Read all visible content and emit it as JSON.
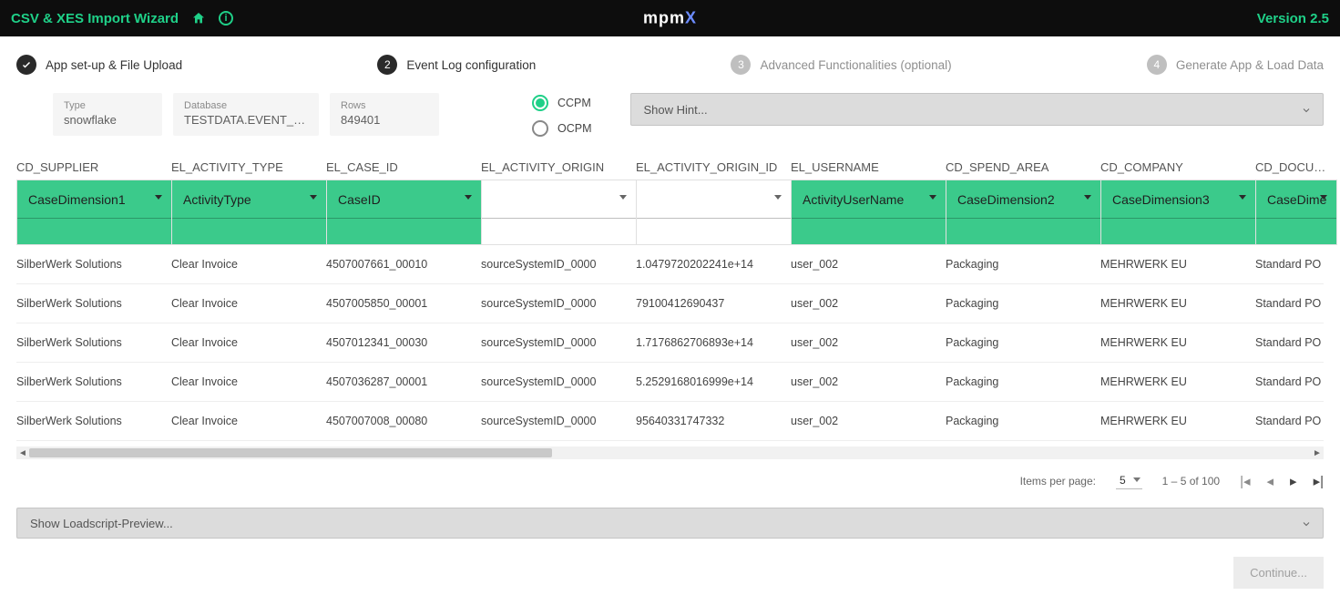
{
  "header": {
    "title": "CSV & XES Import Wizard",
    "logo_main": "mpm",
    "logo_x": "X",
    "version": "Version 2.5"
  },
  "stepper": {
    "s1": "App set-up & File Upload",
    "s1_mark": "✓",
    "s2": "Event Log configuration",
    "s2_num": "2",
    "s3": "Advanced Functionalities (optional)",
    "s3_num": "3",
    "s4": "Generate App & Load Data",
    "s4_num": "4"
  },
  "info": {
    "type_label": "Type",
    "type_value": "snowflake",
    "db_label": "Database",
    "db_value": "TESTDATA.EVENT_LOGS.",
    "rows_label": "Rows",
    "rows_value": "849401"
  },
  "radios": {
    "ccpm": "CCPM",
    "ocpm": "OCPM"
  },
  "hint": "Show Hint...",
  "columns": [
    {
      "header": "CD_SUPPLIER",
      "mapping": "CaseDimension1",
      "green": true
    },
    {
      "header": "EL_ACTIVITY_TYPE",
      "mapping": "ActivityType",
      "green": true
    },
    {
      "header": "EL_CASE_ID",
      "mapping": "CaseID",
      "green": true
    },
    {
      "header": "EL_ACTIVITY_ORIGIN",
      "mapping": "",
      "green": false
    },
    {
      "header": "EL_ACTIVITY_ORIGIN_ID",
      "mapping": "",
      "green": false
    },
    {
      "header": "EL_USERNAME",
      "mapping": "ActivityUserName",
      "green": true
    },
    {
      "header": "CD_SPEND_AREA",
      "mapping": "CaseDimension2",
      "green": true
    },
    {
      "header": "CD_COMPANY",
      "mapping": "CaseDimension3",
      "green": true
    },
    {
      "header": "CD_DOCUMENT",
      "mapping": "CaseDime",
      "green": true
    }
  ],
  "rows": [
    [
      "SilberWerk Solutions",
      "Clear Invoice",
      "4507007661_00010",
      "sourceSystemID_0000",
      "1.0479720202241e+14",
      "user_002",
      "Packaging",
      "MEHRWERK EU",
      "Standard PO"
    ],
    [
      "SilberWerk Solutions",
      "Clear Invoice",
      "4507005850_00001",
      "sourceSystemID_0000",
      "79100412690437",
      "user_002",
      "Packaging",
      "MEHRWERK EU",
      "Standard PO"
    ],
    [
      "SilberWerk Solutions",
      "Clear Invoice",
      "4507012341_00030",
      "sourceSystemID_0000",
      "1.7176862706893e+14",
      "user_002",
      "Packaging",
      "MEHRWERK EU",
      "Standard PO"
    ],
    [
      "SilberWerk Solutions",
      "Clear Invoice",
      "4507036287_00001",
      "sourceSystemID_0000",
      "5.2529168016999e+14",
      "user_002",
      "Packaging",
      "MEHRWERK EU",
      "Standard PO"
    ],
    [
      "SilberWerk Solutions",
      "Clear Invoice",
      "4507007008_00080",
      "sourceSystemID_0000",
      "95640331747332",
      "user_002",
      "Packaging",
      "MEHRWERK EU",
      "Standard PO"
    ]
  ],
  "pagination": {
    "items_label": "Items per page:",
    "items_value": "5",
    "range": "1 – 5 of 100"
  },
  "loadscript": "Show Loadscript-Preview...",
  "continue": "Continue..."
}
